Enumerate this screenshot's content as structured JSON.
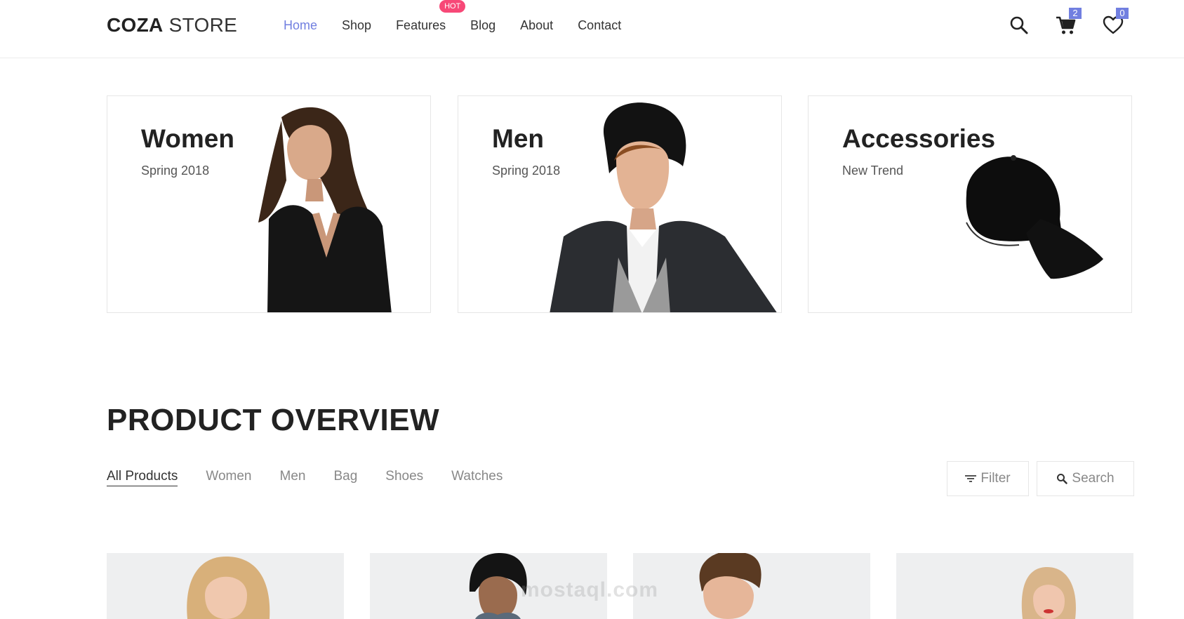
{
  "brand": {
    "logo_bold": "COZA",
    "logo_rest": " STORE"
  },
  "nav": {
    "items": [
      "Home",
      "Shop",
      "Features",
      "Blog",
      "About",
      "Contact"
    ],
    "hot_badge": "HOT",
    "active_color": "#717fe0"
  },
  "header_icons": {
    "search": "search-icon",
    "cart": "cart-icon",
    "cart_count": "2",
    "wishlist": "heart-icon",
    "wishlist_count": "0"
  },
  "banners": [
    {
      "title": "Women",
      "subtitle": "Spring 2018"
    },
    {
      "title": "Men",
      "subtitle": "Spring 2018"
    },
    {
      "title": "Accessories",
      "subtitle": "New Trend"
    }
  ],
  "overview": {
    "title": "PRODUCT OVERVIEW",
    "tabs": [
      "All Products",
      "Women",
      "Men",
      "Bag",
      "Shoes",
      "Watches"
    ],
    "active_tab": "All Products",
    "filter_label": "Filter",
    "search_label": "Search"
  },
  "watermark": {
    "text": "mostaql.com"
  },
  "colors": {
    "accent": "#717fe0",
    "hot": "#f74877",
    "text_dark": "#222222",
    "text_muted": "#888888"
  }
}
